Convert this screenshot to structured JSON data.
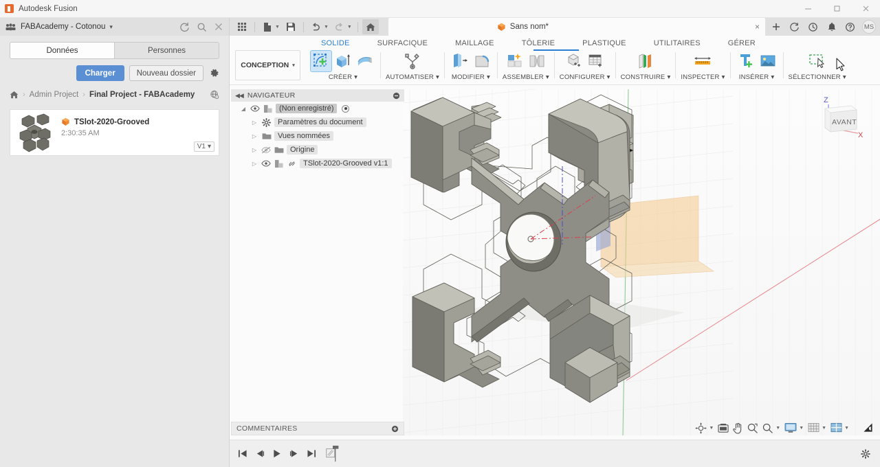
{
  "window": {
    "title": "Autodesk Fusion",
    "app_icon": "fusion-logo-icon",
    "controls": {
      "minimize": "minimize-icon",
      "maximize": "maximize-icon",
      "close": "close-icon"
    }
  },
  "data_panel": {
    "hub_name": "FABAcademy - Cotonou",
    "hub_icon": "team-icon",
    "caret": "▾",
    "header_actions": [
      "refresh-icon",
      "search-icon",
      "close-icon"
    ],
    "tabs": [
      {
        "label": "Données",
        "active": true
      },
      {
        "label": "Personnes",
        "active": false
      }
    ],
    "buttons": {
      "upload": "Charger",
      "new_folder": "Nouveau dossier",
      "settings_icon": "gear-icon"
    },
    "breadcrumb": {
      "home_icon": "home-icon",
      "separator": "›",
      "items": [
        {
          "label": "Admin Project",
          "current": false
        },
        {
          "label": "Final Project - FABAcademy",
          "current": true
        }
      ],
      "globe_icon": "globe-icon"
    },
    "file": {
      "name": "TSlot-2020-Grooved",
      "time": "2:30:35 AM",
      "version": "V1",
      "version_caret": "▾",
      "type_icon": "fusion-cube-icon",
      "thumbnail": "tslot-profile-thumbnail"
    }
  },
  "quick_access": {
    "buttons": [
      {
        "name": "app-grid-icon",
        "has_caret": false
      },
      {
        "name": "new-file-icon",
        "has_caret": true
      },
      {
        "name": "save-icon",
        "has_caret": false
      },
      {
        "name": "undo-icon",
        "has_caret": true
      },
      {
        "name": "redo-icon",
        "has_caret": true
      },
      {
        "name": "home-icon",
        "has_caret": false
      }
    ],
    "document_tab": {
      "label": "Sans nom*",
      "cube_icon": "fusion-cube-icon",
      "close": "×"
    },
    "right_buttons": [
      "add-tab-icon",
      "job-status-icon",
      "recent-icon",
      "notifications-bell-icon",
      "help-icon"
    ],
    "avatar_initials": "MS"
  },
  "ribbon": {
    "tabs": [
      {
        "label": "SOLIDE",
        "active": true
      },
      {
        "label": "SURFACIQUE",
        "active": false
      },
      {
        "label": "MAILLAGE",
        "active": false
      },
      {
        "label": "TÔLERIE",
        "active": false
      },
      {
        "label": "PLASTIQUE",
        "active": false
      },
      {
        "label": "UTILITAIRES",
        "active": false
      },
      {
        "label": "GÉRER",
        "active": false
      }
    ],
    "workspace": {
      "label": "CONCEPTION",
      "caret": "▾"
    },
    "caret": "▾",
    "groups": [
      {
        "label": "CRÉER",
        "icons": [
          "create-sketch-icon",
          "extrude-icon",
          "revolve-icon"
        ]
      },
      {
        "label": "AUTOMATISER",
        "icons": [
          "automate-icon"
        ]
      },
      {
        "label": "MODIFIER",
        "icons": [
          "press-pull-icon",
          "fillet-icon"
        ]
      },
      {
        "label": "ASSEMBLER",
        "icons": [
          "new-component-icon",
          "joint-icon"
        ]
      },
      {
        "label": "CONFIGURER",
        "icons": [
          "configuration-icon",
          "config-table-icon"
        ]
      },
      {
        "label": "CONSTRUIRE",
        "icons": [
          "offset-plane-icon"
        ]
      },
      {
        "label": "INSPECTER",
        "icons": [
          "measure-icon"
        ]
      },
      {
        "label": "INSÉRER",
        "icons": [
          "insert-mcmaster-icon",
          "insert-canvas-icon"
        ]
      },
      {
        "label": "SÉLECTIONNER",
        "icons": [
          "select-window-icon"
        ]
      }
    ]
  },
  "browser": {
    "title": "NAVIGATEUR",
    "collapse_icon": "collapse-left-icon",
    "panel_dot_icon": "minus-circle-icon",
    "rows": [
      {
        "label": "(Non enregistré)",
        "indent": 0,
        "arrow": "◢",
        "eye": "eye-visible-icon",
        "type_icon": "component-icon",
        "root": true,
        "radio": true
      },
      {
        "label": "Paramètres du document",
        "indent": 1,
        "arrow": "▷",
        "eye": "",
        "type_icon": "gear-icon",
        "root": false,
        "radio": false
      },
      {
        "label": "Vues nommées",
        "indent": 1,
        "arrow": "▷",
        "eye": "",
        "type_icon": "folder-icon",
        "root": false,
        "radio": false
      },
      {
        "label": "Origine",
        "indent": 1,
        "arrow": "▷",
        "eye": "eye-hidden-icon",
        "type_icon": "folder-icon",
        "root": false,
        "radio": false
      },
      {
        "label": "TSlot-2020-Grooved v1:1",
        "indent": 1,
        "arrow": "▷",
        "eye": "eye-visible-icon",
        "type_icon": "component-icon",
        "link_icon": "linked-icon",
        "root": false,
        "radio": false
      }
    ]
  },
  "canvas": {
    "model_name": "TSlot-2020-Grooved",
    "body_color": "#8b8b82",
    "sketch_plane_color": "#f2c98a",
    "origin_plane_color": "#9aa6d6",
    "x_axis_color": "#e4606a",
    "y_axis_color": "#6fbf73",
    "grid_color": "#ececec",
    "view_cube": {
      "face_label": "AVANT",
      "axis_z": "Z",
      "axis_x": "X",
      "z_color": "#5a5ad0",
      "x_color": "#d64550"
    },
    "cursor": "arrow-cursor"
  },
  "comments": {
    "label": "COMMENTAIRES",
    "add_icon": "plus-circle-icon"
  },
  "nav_toolbar": {
    "buttons": [
      {
        "name": "orbit-icon",
        "caret": true
      },
      {
        "name": "look-at-icon",
        "caret": false
      },
      {
        "name": "pan-icon",
        "caret": false
      },
      {
        "name": "zoom-icon",
        "caret": false
      },
      {
        "name": "zoom-window-icon",
        "caret": true
      },
      {
        "name": "display-settings-icon",
        "caret": true
      },
      {
        "name": "grid-snap-icon",
        "caret": true
      },
      {
        "name": "viewports-icon",
        "caret": true
      }
    ]
  },
  "timeline": {
    "buttons": [
      "go-to-beginning-icon",
      "step-back-icon",
      "play-icon",
      "step-forward-icon",
      "go-to-end-icon"
    ],
    "marker_icon": "timeline-marker-icon",
    "settings_icon": "gear-icon"
  },
  "status": {
    "badge_icon": "autodesk-mark-icon"
  }
}
